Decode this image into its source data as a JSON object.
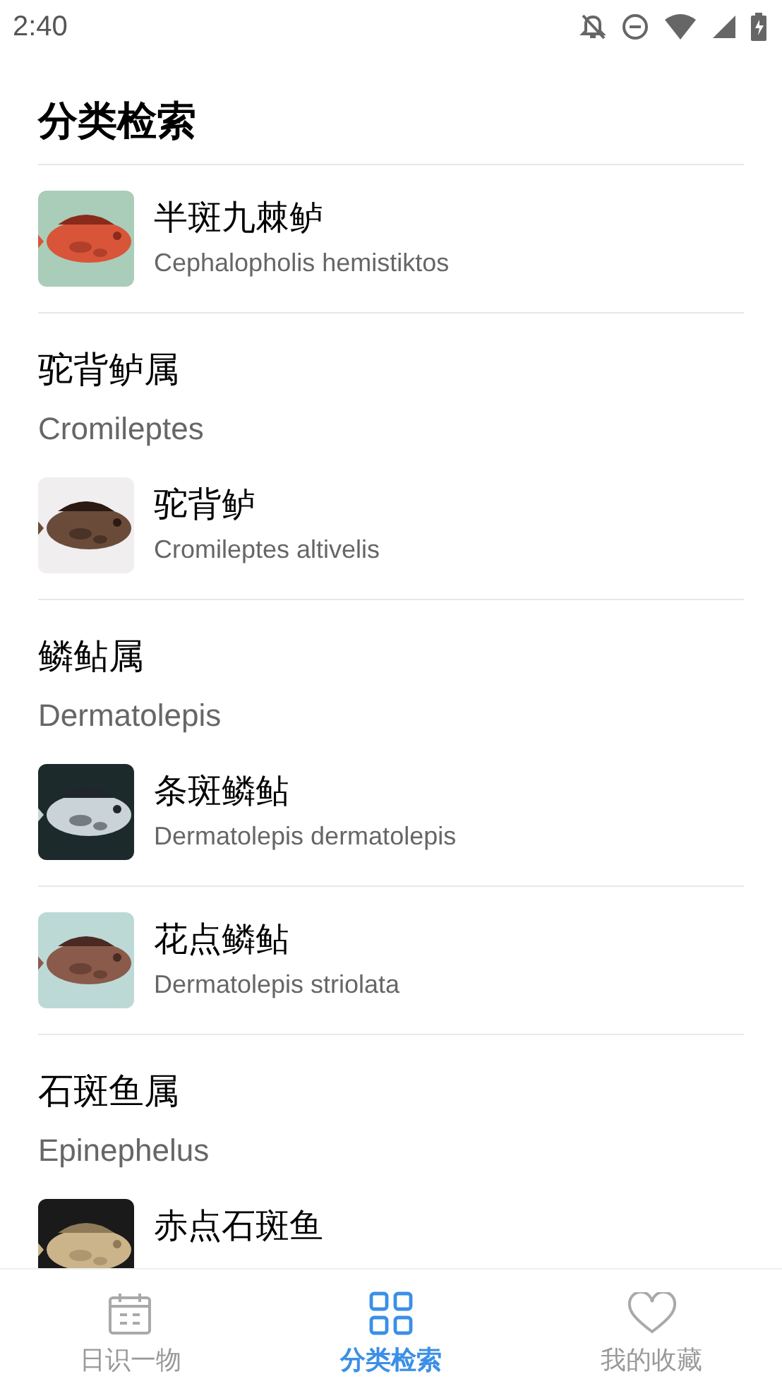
{
  "status_bar": {
    "time": "2:40"
  },
  "title": "分类检索",
  "entries": [
    {
      "kind": "species",
      "name": "半斑九棘鲈",
      "latin": "Cephalopholis hemistiktos"
    },
    {
      "kind": "genus",
      "name": "驼背鲈属",
      "latin": "Cromileptes"
    },
    {
      "kind": "species",
      "name": "驼背鲈",
      "latin": "Cromileptes altivelis"
    },
    {
      "kind": "genus",
      "name": "鳞鲇属",
      "latin": "Dermatolepis"
    },
    {
      "kind": "species",
      "name": "条斑鳞鲇",
      "latin": "Dermatolepis dermatolepis"
    },
    {
      "kind": "species",
      "name": "花点鳞鲇",
      "latin": "Dermatolepis striolata"
    },
    {
      "kind": "genus",
      "name": "石斑鱼属",
      "latin": "Epinephelus"
    },
    {
      "kind": "species",
      "name": "赤点石斑鱼"
    }
  ],
  "tabs": [
    {
      "label": "日识一物",
      "kind": "calendar",
      "selected": false
    },
    {
      "label": "分类检索",
      "kind": "grid",
      "selected": true
    },
    {
      "label": "我的收藏",
      "kind": "heart",
      "selected": false
    }
  ]
}
